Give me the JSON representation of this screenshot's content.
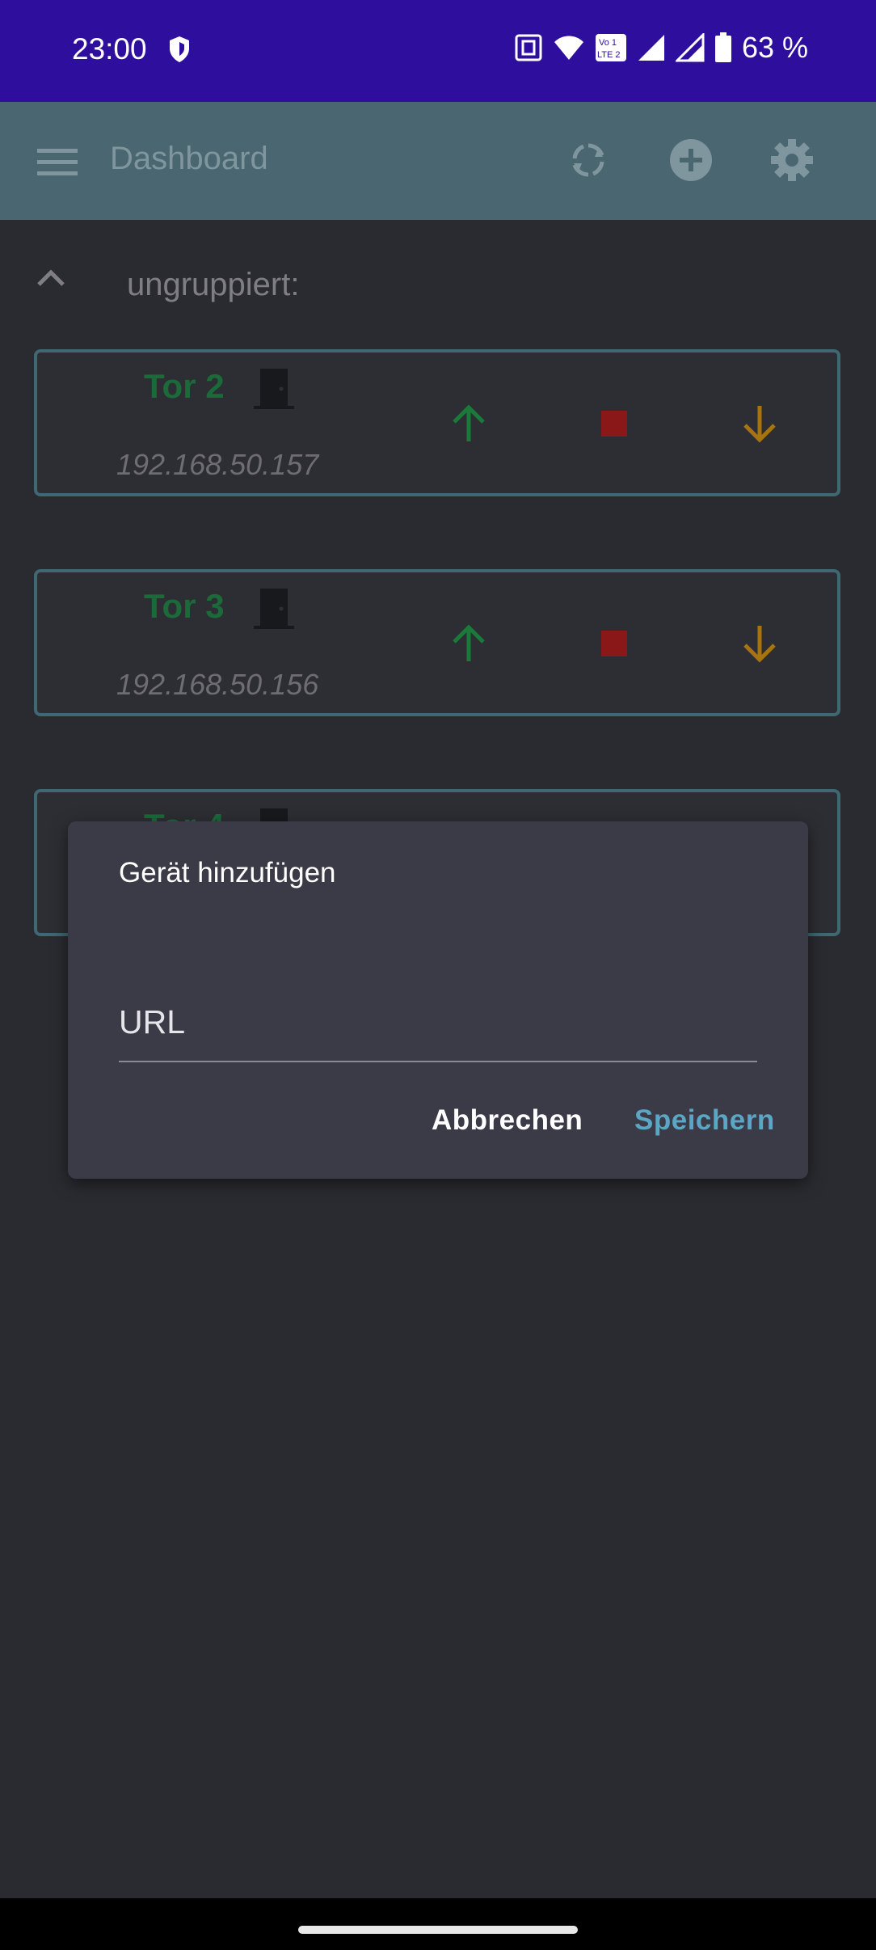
{
  "status_bar": {
    "time": "23:00",
    "battery_percent": "63 %",
    "icons": [
      "shield-icon",
      "nfc-icon",
      "wifi-icon",
      "volte-icon",
      "signal-icon",
      "signal-icon-2",
      "battery-icon"
    ]
  },
  "app_bar": {
    "title": "Dashboard",
    "icons": [
      "menu-icon",
      "refresh-icon",
      "add-icon",
      "settings-icon"
    ]
  },
  "group": {
    "label": "ungruppiert:",
    "icon": "chevron-up-icon"
  },
  "devices": [
    {
      "name": "Tor 2",
      "ip": "192.168.50.157"
    },
    {
      "name": "Tor 3",
      "ip": "192.168.50.156"
    },
    {
      "name": "Tor 4",
      "ip": ""
    }
  ],
  "dialog": {
    "title": "Gerät hinzufügen",
    "input_placeholder": "URL",
    "input_value": "",
    "cancel_label": "Abbrechen",
    "save_label": "Speichern"
  },
  "colors": {
    "status_bar": "#2e0e9c",
    "app_bar": "#4a6670",
    "background": "#2a2b30",
    "card_border": "#3e6872",
    "device_name": "#1a6a3a",
    "up_arrow": "#1a7a3a",
    "stop": "#8a1818",
    "down_arrow": "#a87410",
    "dialog_bg": "#3b3b48",
    "save_accent": "#5aa6c4"
  }
}
